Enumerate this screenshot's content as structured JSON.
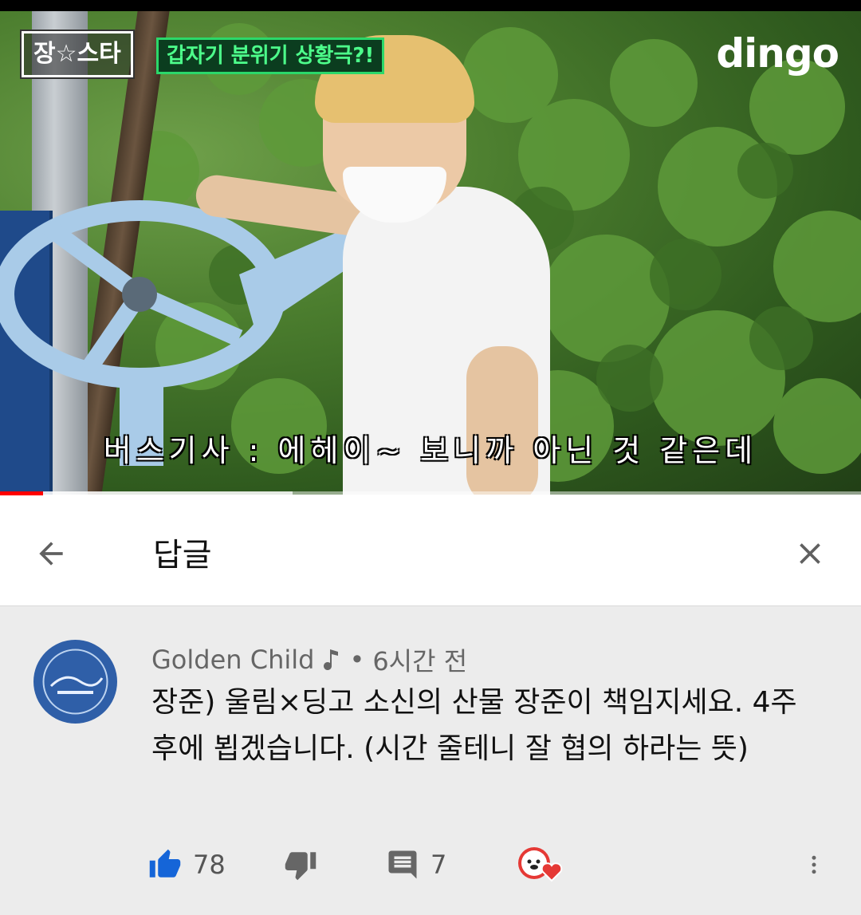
{
  "video": {
    "show_badge": "장☆스타",
    "episode_badge": "갑자기 분위기 상황극?!",
    "channel_logo": "dingo",
    "subtitle": "버스기사 : 에헤이~ 보니까 아닌 것 같은데",
    "progress_played_fraction": 0.05,
    "progress_buffered_fraction": 0.34
  },
  "reply_header": {
    "title": "답글",
    "back_icon": "arrow-left-icon",
    "close_icon": "close-icon"
  },
  "comment": {
    "author": "Golden Child",
    "author_badge_icon": "music-note-icon",
    "separator": "•",
    "time": "6시간 전",
    "text": "장준) 울림×딩고 소신의 산물 장준이 책임지세요. 4주 후에 뵙겠습니다. (시간 줄테니 잘 협의 하라는 뜻)",
    "avatar_color": "#2f5fa8",
    "like_count": "78",
    "reply_count": "7",
    "accent_color": "#1565d8"
  }
}
